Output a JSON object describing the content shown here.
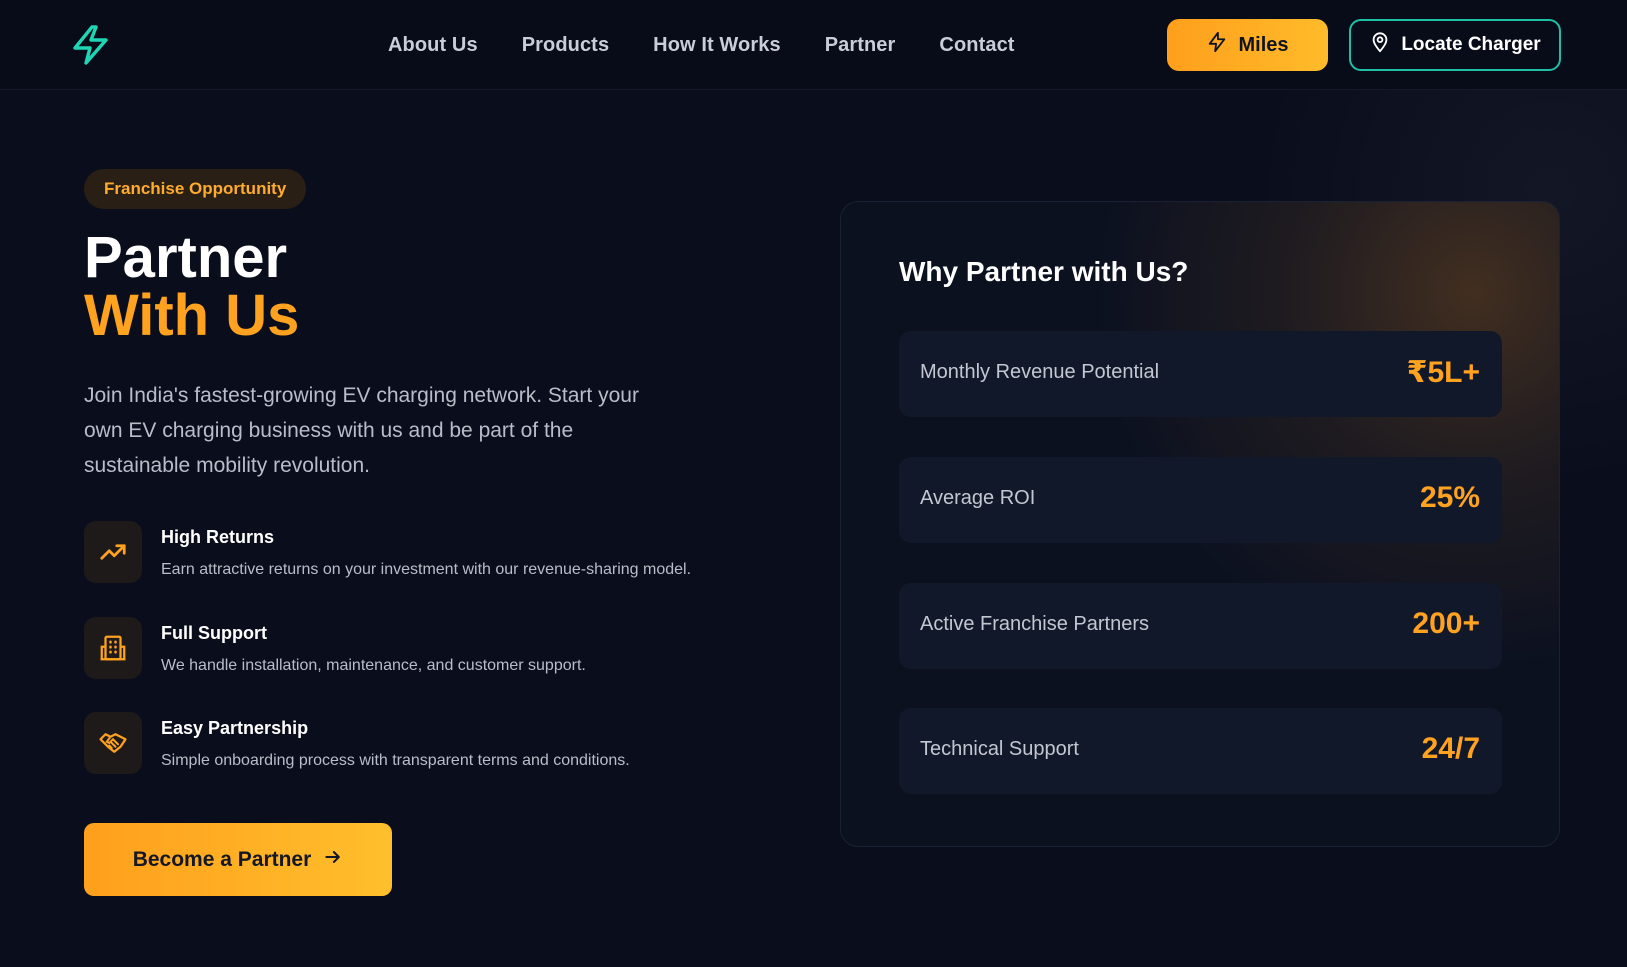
{
  "header": {
    "nav": [
      "About Us",
      "Products",
      "How It Works",
      "Partner",
      "Contact"
    ],
    "miles_label": "Miles",
    "locate_label": "Locate Charger"
  },
  "hero": {
    "badge": "Franchise Opportunity",
    "title_line1": "Partner",
    "title_line2": "With Us",
    "description": "Join India's fastest-growing EV charging network. Start your own EV charging business with us and be part of the sustainable mobility revolution.",
    "features": [
      {
        "title": "High Returns",
        "text": "Earn attractive returns on your investment with our revenue-sharing model.",
        "icon": "trending-up-icon"
      },
      {
        "title": "Full Support",
        "text": "We handle installation, maintenance, and customer support.",
        "icon": "building-icon"
      },
      {
        "title": "Easy Partnership",
        "text": "Simple onboarding process with transparent terms and conditions.",
        "icon": "handshake-icon"
      }
    ],
    "cta_label": "Become a Partner"
  },
  "why": {
    "title": "Why Partner with Us?",
    "stats": [
      {
        "label": "Monthly Revenue Potential",
        "value": "₹5L+"
      },
      {
        "label": "Average ROI",
        "value": "25%"
      },
      {
        "label": "Active Franchise Partners",
        "value": "200+"
      },
      {
        "label": "Technical Support",
        "value": "24/7"
      }
    ]
  },
  "colors": {
    "background": "#0a0e1c",
    "accent_orange": "#ffa21f",
    "accent_teal": "#1fbfa6"
  }
}
